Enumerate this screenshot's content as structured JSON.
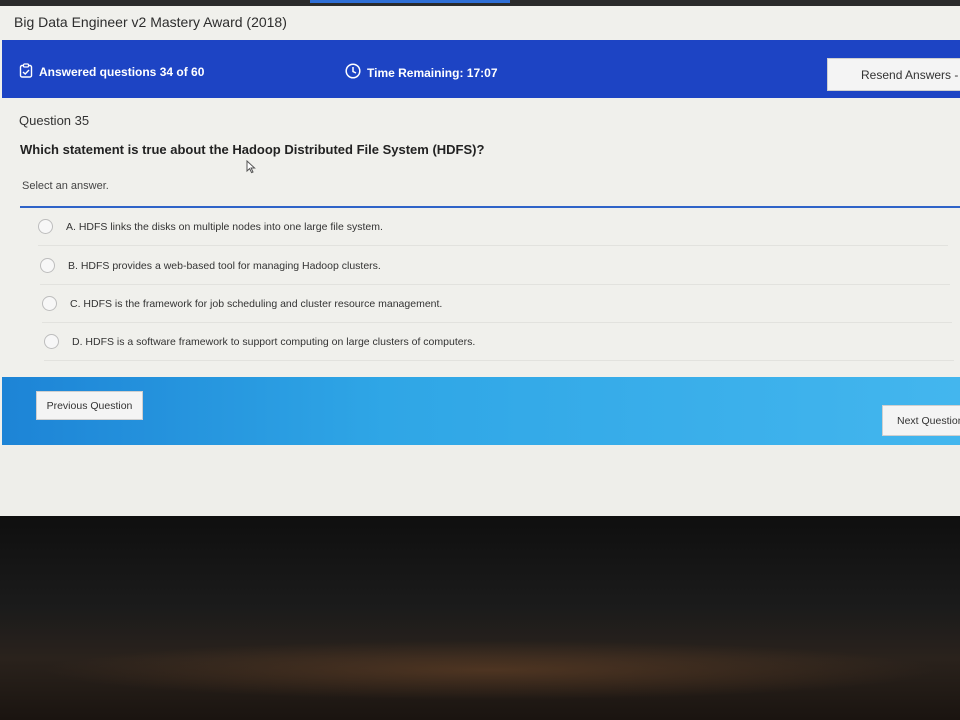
{
  "app": {
    "title": "Big Data Engineer v2 Mastery Award (2018)"
  },
  "header": {
    "answered_label": "Answered questions 34 of 60",
    "timer_label": "Time Remaining: 17:07",
    "resend_label": "Resend Answers - "
  },
  "question": {
    "number_label": "Question 35",
    "text": "Which statement is true about the Hadoop Distributed File System (HDFS)?",
    "instruction": "Select an answer.",
    "options": [
      {
        "label": "A.  HDFS links the disks on multiple nodes into one large file system."
      },
      {
        "label": "B.  HDFS provides a web-based tool for managing Hadoop clusters."
      },
      {
        "label": "C.  HDFS is the framework for job scheduling and cluster resource management."
      },
      {
        "label": "D.  HDFS is a software framework to support computing on large clusters of computers."
      }
    ]
  },
  "footer": {
    "previous_label": "Previous Question",
    "next_label": "Next Question"
  },
  "colors": {
    "header_bar": "#1d44c4",
    "footer_bar": "#2fa6e6",
    "divider": "#2f63c8"
  },
  "icons": {
    "answered": "clipboard-check-icon",
    "timer": "clock-icon",
    "cursor": "mouse-cursor-icon"
  }
}
